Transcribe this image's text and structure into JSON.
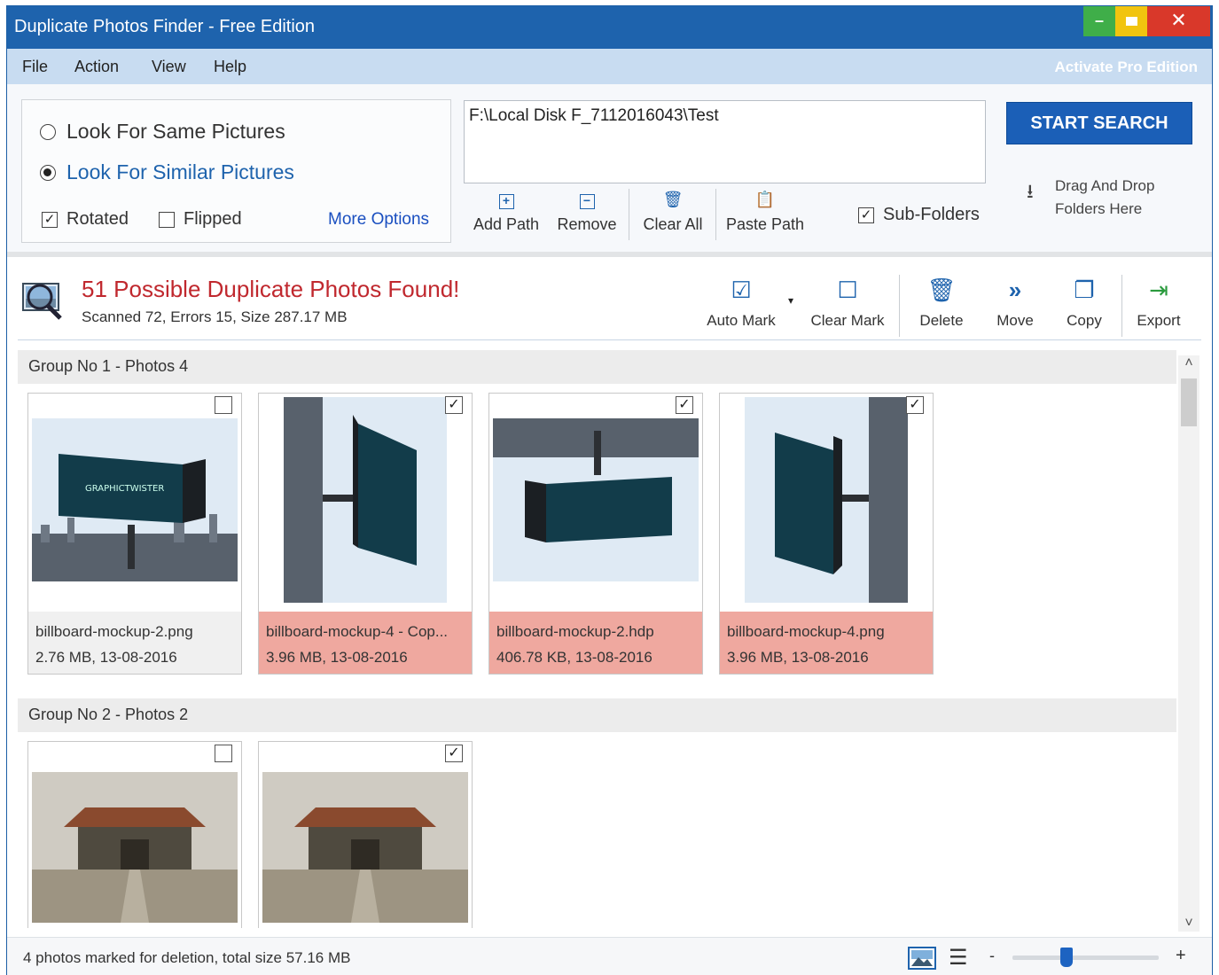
{
  "window": {
    "title": "Duplicate Photos Finder - Free Edition"
  },
  "menu": {
    "items": [
      "File",
      "Action",
      "View",
      "Help"
    ],
    "pro_link": "Activate Pro Edition"
  },
  "search_options": {
    "same_label": "Look For Same Pictures",
    "similar_label": "Look For Similar Pictures",
    "selected": "similar",
    "rotated_label": "Rotated",
    "rotated_checked": true,
    "flipped_label": "Flipped",
    "flipped_checked": false,
    "more_options_label": "More Options"
  },
  "paths": {
    "value": "F:\\Local Disk F_7112016043\\Test",
    "add_label": "Add Path",
    "remove_label": "Remove",
    "clear_label": "Clear All",
    "paste_label": "Paste Path",
    "subfolders_label": "Sub-Folders",
    "subfolders_checked": true
  },
  "start_button": "START SEARCH",
  "drag_drop": {
    "line1": "Drag And Drop",
    "line2": "Folders Here"
  },
  "results": {
    "heading": "51 Possible Duplicate Photos Found!",
    "summary": "Scanned 72, Errors 15, Size 287.17 MB"
  },
  "actions": {
    "auto_mark": "Auto Mark",
    "clear_mark": "Clear Mark",
    "delete": "Delete",
    "move": "Move",
    "copy": "Copy",
    "export": "Export"
  },
  "groups": [
    {
      "header": "Group No 1  -  Photos 4",
      "photos": [
        {
          "name": "billboard-mockup-2.png",
          "meta": "2.76 MB, 13-08-2016",
          "marked": false
        },
        {
          "name": "billboard-mockup-4 - Cop...",
          "meta": "3.96 MB, 13-08-2016",
          "marked": true
        },
        {
          "name": "billboard-mockup-2.hdp",
          "meta": "406.78 KB, 13-08-2016",
          "marked": true
        },
        {
          "name": "billboard-mockup-4.png",
          "meta": "3.96 MB, 13-08-2016",
          "marked": true
        }
      ]
    },
    {
      "header": "Group No 2  -  Photos 2",
      "photos": [
        {
          "name": "",
          "meta": "",
          "marked": false
        },
        {
          "name": "",
          "meta": "",
          "marked": true
        }
      ]
    }
  ],
  "status": {
    "message": "4 photos marked for deletion, total size 57.16 MB",
    "zoom_minus": "-",
    "zoom_plus": "+",
    "zoom_level": 0.36
  },
  "colors": {
    "title_bar": "#1e63ad",
    "menu_bar": "#c8dcf1",
    "found_text": "#c0282e",
    "marked_footer": "#efa89f",
    "accent": "#1b5fb7"
  }
}
